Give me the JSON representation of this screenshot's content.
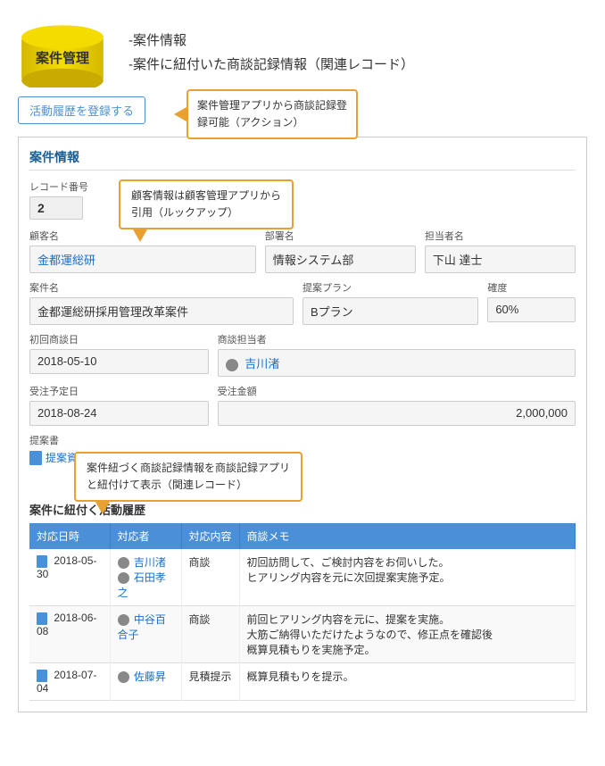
{
  "header": {
    "db_label": "案件管理",
    "bullet1": "-案件情報",
    "bullet2": "-案件に紐付いた商談記録情報（関連レコード）"
  },
  "action": {
    "button_label": "活動履歴を登録する",
    "callout_text": "案件管理アプリから商談記録登\n録可能（アクション）"
  },
  "case_info": {
    "section_title": "案件情報",
    "lookup_callout": "顧客情報は顧客管理アプリから\n引用（ルックアップ）",
    "record_number_label": "レコード番号",
    "record_number_value": "2",
    "customer_name_label": "顧客名",
    "customer_name_value": "金都運総研",
    "department_label": "部署名",
    "department_value": "情報システム部",
    "person_in_charge_label": "担当者名",
    "person_in_charge_value": "下山 達士",
    "case_name_label": "案件名",
    "case_name_value": "金都運総研採用管理改革案件",
    "proposal_plan_label": "提案プラン",
    "proposal_plan_value": "Bプラン",
    "certainty_label": "確度",
    "certainty_value": "60%",
    "first_meeting_label": "初回商談日",
    "first_meeting_value": "2018-05-10",
    "meeting_person_label": "商談担当者",
    "meeting_person_value": "吉川渚",
    "order_date_label": "受注予定日",
    "order_date_value": "2018-08-24",
    "order_amount_label": "受注金額",
    "order_amount_value": "2,000,000",
    "proposal_doc_label": "提案書",
    "proposal_doc_value": "提案資料.pptx (940 KB)"
  },
  "related": {
    "callout_text": "案件紐づく商談記録情報を商談記録アプリ\nと紐付けて表示（関連レコード）",
    "section_title": "案件に紐付く活動履歴",
    "columns": [
      "対応日時",
      "対応者",
      "対応内容",
      "商談メモ"
    ],
    "rows": [
      {
        "date": "2018-05-30",
        "person": "吉川渚\n石田孝之",
        "content": "商談",
        "memo": "初回訪問して、ご検討内容をお伺いした。\nヒアリング内容を元に次回提案実施予定。"
      },
      {
        "date": "2018-06-08",
        "person": "中谷百合子",
        "content": "商談",
        "memo": "前回ヒアリング内容を元に、提案を実施。\n大筋ご納得いただけたようなので、修正点を確認後\n概算見積もりを実施予定。"
      },
      {
        "date": "2018-07-04",
        "person": "佐藤昇",
        "content": "見積提示",
        "memo": "概算見積もりを提示。"
      }
    ]
  }
}
